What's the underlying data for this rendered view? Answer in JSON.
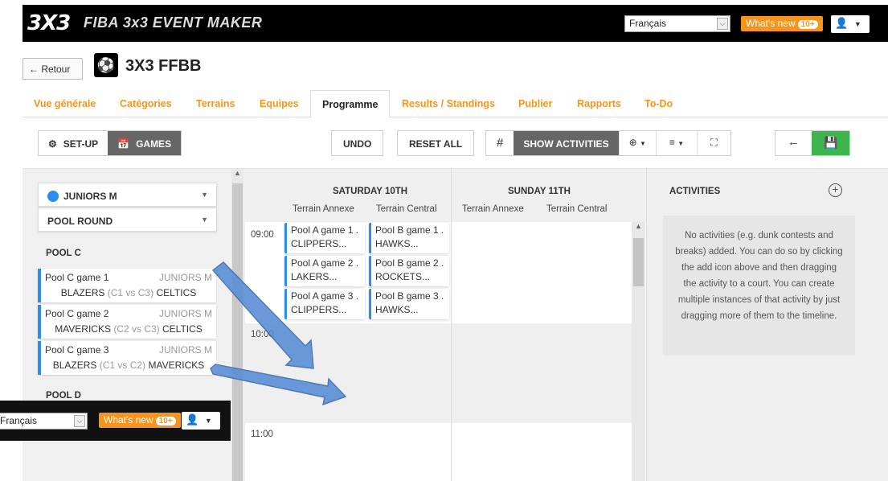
{
  "topbar": {
    "logo": "3X3",
    "app_title": "FIBA 3x3 EVENT MAKER",
    "language": "Français",
    "whats_new_label": "What's new",
    "whats_new_count": "10+"
  },
  "header": {
    "back_label": "← Retour",
    "event_name": "3X3 FFBB"
  },
  "tabs": [
    {
      "label": "Vue générale"
    },
    {
      "label": "Catégories"
    },
    {
      "label": "Terrains"
    },
    {
      "label": "Equipes"
    },
    {
      "label": "Programme"
    },
    {
      "label": "Results / Standings"
    },
    {
      "label": "Publier"
    },
    {
      "label": "Rapports"
    },
    {
      "label": "To-Do"
    }
  ],
  "toolbar": {
    "setup": "SET-UP",
    "games": "GAMES",
    "undo": "UNDO",
    "reset_all": "RESET ALL",
    "hash": "#",
    "show_activities": "SHOW ACTIVITIES"
  },
  "left": {
    "category": "JUNIORS M",
    "round": "POOL ROUND",
    "pool_c": "POOL C",
    "pool_d": "POOL D",
    "games": [
      {
        "name": "Pool C game 1",
        "cat": "JUNIORS M",
        "home": "BLAZERS",
        "pairing": "(C1 vs C3)",
        "away": "CELTICS"
      },
      {
        "name": "Pool C game 2",
        "cat": "JUNIORS M",
        "home": "MAVERICKS",
        "pairing": "(C2 vs C3)",
        "away": "CELTICS"
      },
      {
        "name": "Pool C game 3",
        "cat": "JUNIORS M",
        "home": "BLAZERS",
        "pairing": "(C1 vs C2)",
        "away": "MAVERICKS"
      }
    ]
  },
  "schedule": {
    "days": [
      {
        "label": "SATURDAY 10TH",
        "courts": [
          "Terrain Annexe",
          "Terrain Central"
        ]
      },
      {
        "label": "SUNDAY 11TH",
        "courts": [
          "Terrain Annexe",
          "Terrain Central"
        ]
      }
    ],
    "times": [
      "09:00",
      "10:00",
      "11:00"
    ],
    "slots": [
      {
        "title": "Pool A game 1 .",
        "team": "CLIPPERS..."
      },
      {
        "title": "Pool B game 1 .",
        "team": "HAWKS..."
      },
      {
        "title": "Pool A game 2 .",
        "team": "LAKERS..."
      },
      {
        "title": "Pool B game 2 .",
        "team": "ROCKETS..."
      },
      {
        "title": "Pool A game 3 .",
        "team": "CLIPPERS..."
      },
      {
        "title": "Pool B game 3 .",
        "team": "HAWKS..."
      }
    ]
  },
  "activities": {
    "title": "ACTIVITIES",
    "empty_message": "No activities (e.g. dunk contests and breaks) added. You can do so by clicking the add icon above and then dragging the activity to a court. You can create multiple instances of that activity by just dragging more of them to the timeline."
  },
  "overlay": {
    "language": "Français",
    "whats_new_label": "What's new",
    "whats_new_count": "10+"
  },
  "colors": {
    "accent_orange": "#f7941d",
    "game_blue": "#2d8cf0",
    "save_green": "#3cb54a",
    "arrow_blue": "#5b8fd6"
  }
}
